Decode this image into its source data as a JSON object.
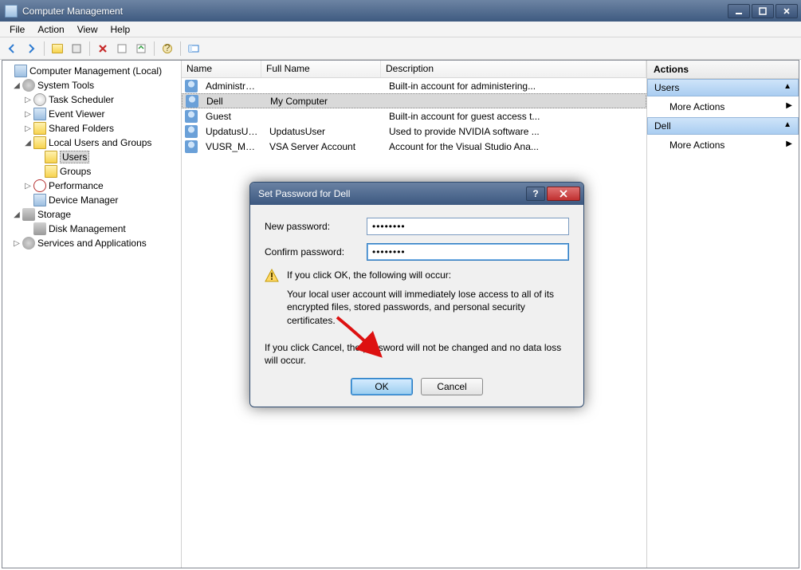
{
  "window": {
    "title": "Computer Management"
  },
  "menu": {
    "file": "File",
    "action": "Action",
    "view": "View",
    "help": "Help"
  },
  "tree": {
    "root": "Computer Management (Local)",
    "system_tools": "System Tools",
    "task_scheduler": "Task Scheduler",
    "event_viewer": "Event Viewer",
    "shared_folders": "Shared Folders",
    "local_users": "Local Users and Groups",
    "users": "Users",
    "groups": "Groups",
    "performance": "Performance",
    "device_manager": "Device Manager",
    "storage": "Storage",
    "disk_management": "Disk Management",
    "services_apps": "Services and Applications"
  },
  "list": {
    "cols": {
      "name": "Name",
      "full": "Full Name",
      "desc": "Description"
    },
    "rows": [
      {
        "name": "Administrator",
        "full": "",
        "desc": "Built-in account for administering..."
      },
      {
        "name": "Dell",
        "full": "My Computer",
        "desc": ""
      },
      {
        "name": "Guest",
        "full": "",
        "desc": "Built-in account for guest access t..."
      },
      {
        "name": "UpdatusUser",
        "full": "UpdatusUser",
        "desc": "Used to provide NVIDIA software ..."
      },
      {
        "name": "VUSR_MY_D...",
        "full": "VSA Server Account",
        "desc": "Account for the Visual Studio Ana..."
      }
    ]
  },
  "actions": {
    "header": "Actions",
    "sect1": "Users",
    "more1": "More Actions",
    "sect2": "Dell",
    "more2": "More Actions"
  },
  "dialog": {
    "title": "Set Password for Dell",
    "new_label": "New password:",
    "confirm_label": "Confirm password:",
    "new_value": "••••••••",
    "confirm_value": "••••••••",
    "warn_head": "If you click OK, the following will occur:",
    "warn_body": "Your local user account will immediately lose access to all of its encrypted files, stored passwords, and personal security certificates.",
    "cancel_msg": "If you click Cancel, the password will not be changed and no data loss will occur.",
    "ok": "OK",
    "cancel": "Cancel"
  }
}
